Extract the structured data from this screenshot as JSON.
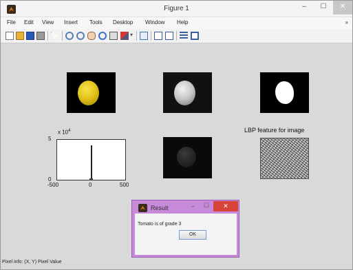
{
  "window": {
    "title": "Figure 1",
    "minimize": "–",
    "maximize": "☐",
    "close": "✕"
  },
  "menu": [
    "File",
    "Edit",
    "View",
    "Insert",
    "Tools",
    "Desktop",
    "Window",
    "Help"
  ],
  "menu_overflow": "»",
  "toolbar_icons": [
    "new-figure-icon",
    "open-file-icon",
    "save-icon",
    "print-icon",
    "pointer-icon",
    "zoom-in-icon",
    "zoom-out-icon",
    "pan-icon",
    "rotate-3d-icon",
    "data-cursor-icon",
    "brush-icon",
    "link-plot-icon",
    "colorbar-icon",
    "legend-icon",
    "hide-plot-tools-icon",
    "show-plot-tools-icon"
  ],
  "histogram": {
    "exponent_label": "x 10",
    "exponent_power": "4",
    "y_tick_top": "5",
    "y_tick_bottom": "0",
    "x_ticks": [
      "-500",
      "0",
      "500"
    ]
  },
  "lbp_title": "LBP feature for image",
  "status": "Pixel info: (X, Y)  Pixel Value",
  "dialog": {
    "title": "Result",
    "minimize": "–",
    "maximize": "☐",
    "close": "✕",
    "message": "Tomato is of grade 3",
    "ok_label": "OK"
  },
  "colors": {
    "dialog_frame": "#c68ad8",
    "dialog_close": "#d9443a",
    "figure_background": "#d9d9d9"
  }
}
